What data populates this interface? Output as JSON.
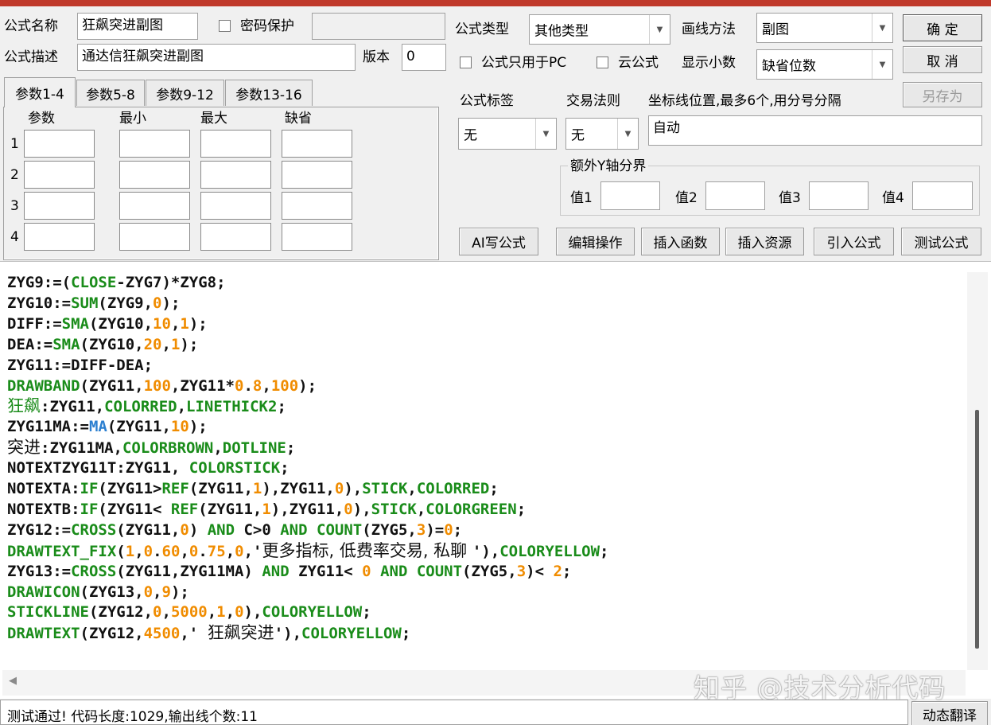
{
  "header": {
    "name_label": "公式名称",
    "name_value": "狂飙突进副图",
    "password_label": "密码保护",
    "desc_label": "公式描述",
    "desc_value": "通达信狂飙突进副图",
    "version_label": "版本",
    "version_value": "0",
    "type_label": "公式类型",
    "type_value": "其他类型",
    "draw_label": "画线方法",
    "draw_value": "副图",
    "pc_only_label": "公式只用于PC",
    "cloud_label": "云公式",
    "decimals_label": "显示小数",
    "decimals_value": "缺省位数"
  },
  "buttons": {
    "ok": "确  定",
    "cancel": "取  消",
    "save_as": "另存为",
    "ai": "AI写公式",
    "edit": "编辑操作",
    "insert_func": "插入函数",
    "insert_res": "插入资源",
    "import": "引入公式",
    "test": "测试公式",
    "translate": "动态翻译"
  },
  "tabs": [
    "参数1-4",
    "参数5-8",
    "参数9-12",
    "参数13-16"
  ],
  "param_table": {
    "headers": [
      "参数",
      "最小",
      "最大",
      "缺省"
    ],
    "rows": [
      "1",
      "2",
      "3",
      "4"
    ]
  },
  "right": {
    "tag_label": "公式标签",
    "tag_value": "无",
    "rule_label": "交易法则",
    "rule_value": "无",
    "coord_label": "坐标线位置,最多6个,用分号分隔",
    "coord_value": "自动",
    "yaxis_group": "额外Y轴分界",
    "v1": "值1",
    "v2": "值2",
    "v3": "值3",
    "v4": "值4"
  },
  "code": [
    [
      [
        "ZYG9:=(",
        ""
      ],
      [
        "CLOSE",
        "kw"
      ],
      [
        "-ZYG7)*ZYG8;",
        ""
      ]
    ],
    [
      [
        "ZYG10:=",
        ""
      ],
      [
        "SUM",
        "kw"
      ],
      [
        "(ZYG9,",
        ""
      ],
      [
        "0",
        "num"
      ],
      [
        ");",
        ""
      ]
    ],
    [
      [
        "DIFF:=",
        ""
      ],
      [
        "SMA",
        "kw"
      ],
      [
        "(ZYG10,",
        ""
      ],
      [
        "10",
        "num"
      ],
      [
        ",",
        ""
      ],
      [
        "1",
        "num"
      ],
      [
        ");",
        ""
      ]
    ],
    [
      [
        "DEA:=",
        ""
      ],
      [
        "SMA",
        "kw"
      ],
      [
        "(ZYG10,",
        ""
      ],
      [
        "20",
        "num"
      ],
      [
        ",",
        ""
      ],
      [
        "1",
        "num"
      ],
      [
        ");",
        ""
      ]
    ],
    [
      [
        "ZYG11:=DIFF-DEA;",
        ""
      ]
    ],
    [
      [
        "DRAWBAND",
        "kw"
      ],
      [
        "(ZYG11,",
        ""
      ],
      [
        "100",
        "num"
      ],
      [
        ",ZYG11*",
        ""
      ],
      [
        "0",
        "num"
      ],
      [
        ".",
        ""
      ],
      [
        "8",
        "num"
      ],
      [
        ",",
        ""
      ],
      [
        "100",
        "num"
      ],
      [
        ");",
        ""
      ]
    ],
    [
      [
        "狂飙",
        "kwcn"
      ],
      [
        ":ZYG11,",
        ""
      ],
      [
        "COLORRED",
        "kw"
      ],
      [
        ",",
        ""
      ],
      [
        "LINETHICK2",
        "kw"
      ],
      [
        ";",
        ""
      ]
    ],
    [
      [
        "ZYG11MA:=",
        ""
      ],
      [
        "MA",
        "bl"
      ],
      [
        "(ZYG11,",
        ""
      ],
      [
        "10",
        "num"
      ],
      [
        ");",
        ""
      ]
    ],
    [
      [
        "突进",
        "cn"
      ],
      [
        ":ZYG11MA,",
        ""
      ],
      [
        "COLORBROWN",
        "kw"
      ],
      [
        ",",
        ""
      ],
      [
        "DOTLINE",
        "kw"
      ],
      [
        ";",
        ""
      ]
    ],
    [
      [
        "NOTEXTZYG11T:ZYG11, ",
        ""
      ],
      [
        "COLORSTICK",
        "kw"
      ],
      [
        ";",
        ""
      ]
    ],
    [
      [
        "NOTEXTA:",
        ""
      ],
      [
        "IF",
        "kw"
      ],
      [
        "(ZYG11>",
        ""
      ],
      [
        "REF",
        "kw"
      ],
      [
        "(ZYG11,",
        ""
      ],
      [
        "1",
        "num"
      ],
      [
        "),ZYG11,",
        ""
      ],
      [
        "0",
        "num"
      ],
      [
        "),",
        ""
      ],
      [
        "STICK",
        "kw"
      ],
      [
        ",",
        ""
      ],
      [
        "COLORRED",
        "kw"
      ],
      [
        ";",
        ""
      ]
    ],
    [
      [
        "NOTEXTB:",
        ""
      ],
      [
        "IF",
        "kw"
      ],
      [
        "(ZYG11< ",
        ""
      ],
      [
        "REF",
        "kw"
      ],
      [
        "(ZYG11,",
        ""
      ],
      [
        "1",
        "num"
      ],
      [
        "),ZYG11,",
        ""
      ],
      [
        "0",
        "num"
      ],
      [
        "),",
        ""
      ],
      [
        "STICK",
        "kw"
      ],
      [
        ",",
        ""
      ],
      [
        "COLORGREEN",
        "kw"
      ],
      [
        ";",
        ""
      ]
    ],
    [
      [
        "ZYG12:=",
        ""
      ],
      [
        "CROSS",
        "kw"
      ],
      [
        "(ZYG11,",
        ""
      ],
      [
        "0",
        "num"
      ],
      [
        ") ",
        ""
      ],
      [
        "AND",
        "kw"
      ],
      [
        " C>0 ",
        ""
      ],
      [
        "AND",
        "kw"
      ],
      [
        " ",
        ""
      ],
      [
        "COUNT",
        "kw"
      ],
      [
        "(ZYG5,",
        ""
      ],
      [
        "3",
        "num"
      ],
      [
        ")=",
        ""
      ],
      [
        "0",
        "num"
      ],
      [
        ";",
        ""
      ]
    ],
    [
      [
        "DRAWTEXT_FIX",
        "kw"
      ],
      [
        "(",
        ""
      ],
      [
        "1",
        "num"
      ],
      [
        ",",
        ""
      ],
      [
        "0",
        "num"
      ],
      [
        ".",
        ""
      ],
      [
        "60",
        "num"
      ],
      [
        ",",
        ""
      ],
      [
        "0",
        "num"
      ],
      [
        ".",
        ""
      ],
      [
        "75",
        "num"
      ],
      [
        ",",
        ""
      ],
      [
        "0",
        "num"
      ],
      [
        ",'",
        ""
      ],
      [
        "更多指标, 低费率交易, 私聊 ",
        "cn"
      ],
      [
        "'),",
        ""
      ],
      [
        "COLORYELLOW",
        "kw"
      ],
      [
        ";",
        ""
      ]
    ],
    [
      [
        "ZYG13:=",
        ""
      ],
      [
        "CROSS",
        "kw"
      ],
      [
        "(ZYG11,ZYG11MA) ",
        ""
      ],
      [
        "AND",
        "kw"
      ],
      [
        " ZYG11< ",
        ""
      ],
      [
        "0",
        "num"
      ],
      [
        " ",
        ""
      ],
      [
        "AND",
        "kw"
      ],
      [
        " ",
        ""
      ],
      [
        "COUNT",
        "kw"
      ],
      [
        "(ZYG5,",
        ""
      ],
      [
        "3",
        "num"
      ],
      [
        ")< ",
        ""
      ],
      [
        "2",
        "num"
      ],
      [
        ";",
        ""
      ]
    ],
    [
      [
        "DRAWICON",
        "kw"
      ],
      [
        "(ZYG13,",
        ""
      ],
      [
        "0",
        "num"
      ],
      [
        ",",
        ""
      ],
      [
        "9",
        "num"
      ],
      [
        ");",
        ""
      ]
    ],
    [
      [
        "STICKLINE",
        "kw"
      ],
      [
        "(ZYG12,",
        ""
      ],
      [
        "0",
        "num"
      ],
      [
        ",",
        ""
      ],
      [
        "5000",
        "num"
      ],
      [
        ",",
        ""
      ],
      [
        "1",
        "num"
      ],
      [
        ",",
        ""
      ],
      [
        "0",
        "num"
      ],
      [
        "),",
        ""
      ],
      [
        "COLORYELLOW",
        "kw"
      ],
      [
        ";",
        ""
      ]
    ],
    [
      [
        "DRAWTEXT",
        "kw"
      ],
      [
        "(ZYG12,",
        ""
      ],
      [
        "4500",
        "num"
      ],
      [
        ",' ",
        ""
      ],
      [
        "狂飙突进",
        "cn"
      ],
      [
        "'),",
        ""
      ],
      [
        "COLORYELLOW",
        "kw"
      ],
      [
        ";",
        ""
      ]
    ]
  ],
  "status": "测试通过! 代码长度:1029,输出线个数:11",
  "watermark": "知乎 @技术分析代码",
  "colors": {
    "keyword": "#1a8c1a",
    "number": "#f08c00",
    "function_blue": "#2b7fd0",
    "title_bar": "#c0392b"
  }
}
